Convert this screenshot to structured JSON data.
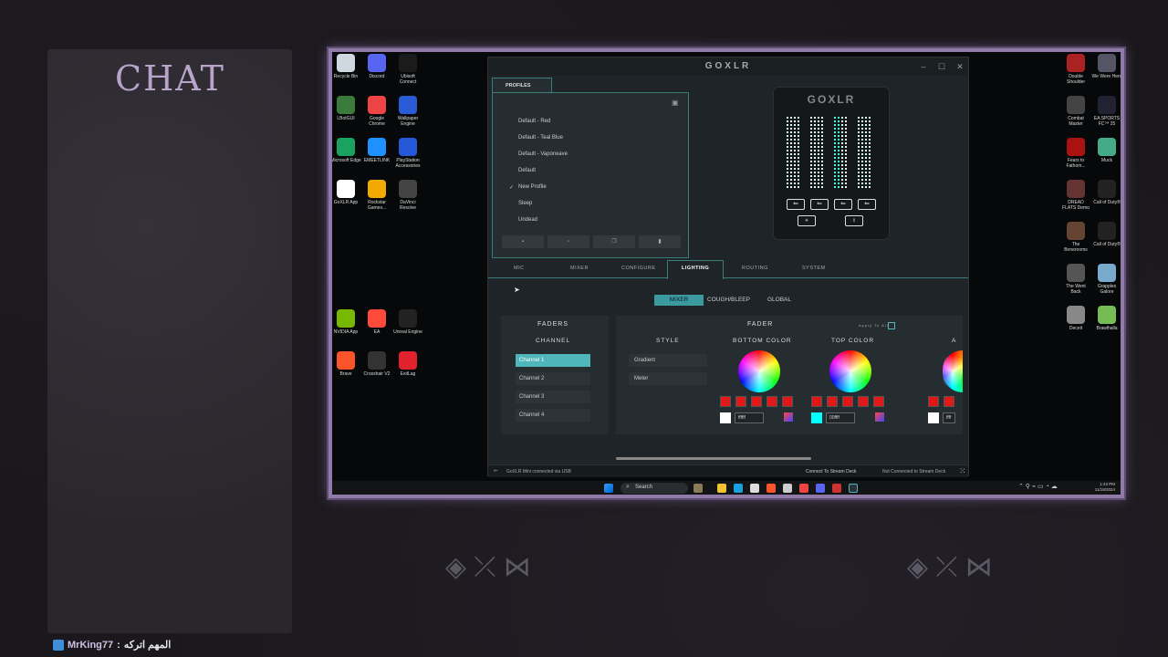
{
  "chat": {
    "title": "CHAT",
    "message_user": "MrKing77",
    "message_sep": ":",
    "message_text": "المهم اتركه"
  },
  "desktop": {
    "left_icons": [
      {
        "label": "Recycle Bin",
        "color": "#cfd8e0"
      },
      {
        "label": "Discord",
        "color": "#5865f2"
      },
      {
        "label": "Ubisoft Connect",
        "color": "#1b1b1b"
      },
      {
        "label": "LBotGUI",
        "color": "#3a7a3a"
      },
      {
        "label": "Google Chrome",
        "color": "#e44"
      },
      {
        "label": "Wallpaper Engine",
        "color": "#2a5bd7"
      },
      {
        "label": "Microsoft Edge",
        "color": "#1aa260"
      },
      {
        "label": "EMEETLINK",
        "color": "#1e90ff"
      },
      {
        "label": "PlayStation Accessories",
        "color": "#2458d6"
      },
      {
        "label": "GoXLR App",
        "color": "#ffffff"
      },
      {
        "label": "Rockstar Games...",
        "color": "#f2a900"
      },
      {
        "label": "DaVinci Resolve",
        "color": "#444"
      },
      {
        "label": "NVIDIA App",
        "color": "#76b900"
      },
      {
        "label": "EA",
        "color": "#ff4a3a"
      },
      {
        "label": "Unreal Engine",
        "color": "#222"
      },
      {
        "label": "Brave",
        "color": "#fb542b"
      },
      {
        "label": "Crosshair V2",
        "color": "#333"
      },
      {
        "label": "ExitLag",
        "color": "#e0222c"
      }
    ],
    "right_icons": [
      {
        "label": "Double Shoulder",
        "color": "#a22"
      },
      {
        "label": "We Were Here",
        "color": "#556"
      },
      {
        "label": "Combat Master",
        "color": "#444"
      },
      {
        "label": "EA SPORTS FC™ 25",
        "color": "#223"
      },
      {
        "label": "Fears to Fathom...",
        "color": "#a11"
      },
      {
        "label": "Muck",
        "color": "#4a8"
      },
      {
        "label": "DREAD FLATS Demo",
        "color": "#633"
      },
      {
        "label": "Call of Duty®",
        "color": "#222"
      },
      {
        "label": "The Bonerooms",
        "color": "#643"
      },
      {
        "label": "Call of Duty®",
        "color": "#222"
      },
      {
        "label": "The Went Back",
        "color": "#555"
      },
      {
        "label": "Grapples Galore",
        "color": "#7ac"
      },
      {
        "label": "Deceit",
        "color": "#888"
      },
      {
        "label": "Brawlhalla",
        "color": "#7b5"
      }
    ]
  },
  "goxlr": {
    "title": "GOXLR",
    "profiles_tab": "PROFILES",
    "profiles": [
      "Default - Red",
      "Default - Teal Blue",
      "Default - Vaporwave",
      "Default",
      "New Profile",
      "Sleep",
      "Undead"
    ],
    "selected_profile_check": "✓",
    "device_logo": "GOXLR",
    "tabs": [
      "MIC",
      "MIXER",
      "CONFIGURE",
      "LIGHTING",
      "ROUTING",
      "SYSTEM"
    ],
    "active_tab": "LIGHTING",
    "subtabs": [
      "MIXER",
      "COUGH/BLEEP",
      "GLOBAL"
    ],
    "faders_heading": "FADERS",
    "channel_heading": "CHANNEL",
    "channels": [
      "Channel 1",
      "Channel 2",
      "Channel 3",
      "Channel 4"
    ],
    "fader_heading": "FADER",
    "apply_to_all": "Apply To All",
    "style_heading": "STYLE",
    "styles": [
      "Gradient",
      "Meter"
    ],
    "bottom_color_heading": "BOTTOM COLOR",
    "top_color_heading": "TOP COLOR",
    "bottom_hex": "ffffff",
    "top_hex": "00ffff",
    "third_hex": "ffff",
    "third_heading": "A",
    "status_connected": "GoXLR Mini connected via USB",
    "status_stream_deck_link": "Connect To Stream Deck",
    "status_stream_deck": "Not Connected to Stream Deck"
  },
  "taskbar": {
    "search_placeholder": "Search",
    "clock_time": "1:43 PM",
    "clock_date": "11/18/2024"
  },
  "colors": {
    "accent": "#3b9aa0",
    "frame": "#8f7aa8",
    "chat_title": "#b7a4c8",
    "swatch_red": "#e01818"
  }
}
